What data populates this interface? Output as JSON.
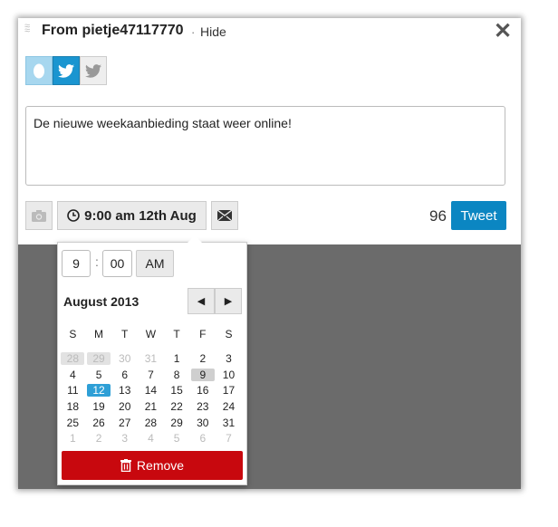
{
  "header": {
    "title": "From pietje47117770",
    "separator": "·",
    "hide_label": "Hide",
    "close_icon": "close-icon"
  },
  "accounts": [
    "egg-avatar-icon",
    "twitter-icon",
    "twitter-icon"
  ],
  "composer": {
    "text": "De nieuwe weekaanbieding staat weer online!"
  },
  "toolbar": {
    "camera_icon": "camera-icon",
    "schedule_label": "9:00 am 12th Aug",
    "clock_icon": "clock-icon",
    "mail_icon": "mail-icon",
    "char_count": "96",
    "tweet_label": "Tweet"
  },
  "scheduler": {
    "hour": "9",
    "colon": ":",
    "minute": "00",
    "ampm": "AM",
    "month_label": "August 2013",
    "prev_symbol": "◀",
    "next_symbol": "▶",
    "weekdays": [
      "S",
      "M",
      "T",
      "W",
      "T",
      "F",
      "S"
    ],
    "weeks": [
      [
        "28",
        "29",
        "30",
        "31",
        "1",
        "2",
        "3"
      ],
      [
        "4",
        "5",
        "6",
        "7",
        "8",
        "9",
        "10"
      ],
      [
        "11",
        "12",
        "13",
        "14",
        "15",
        "16",
        "17"
      ],
      [
        "18",
        "19",
        "20",
        "21",
        "22",
        "23",
        "24"
      ],
      [
        "25",
        "26",
        "27",
        "28",
        "29",
        "30",
        "31"
      ],
      [
        "1",
        "2",
        "3",
        "4",
        "5",
        "6",
        "7"
      ]
    ],
    "remove_label": "Remove",
    "remove_icon": "trash-icon",
    "colors": {
      "selected": "#2e9fd6",
      "remove": "#c8080e",
      "tweet": "#0b86c2"
    }
  }
}
